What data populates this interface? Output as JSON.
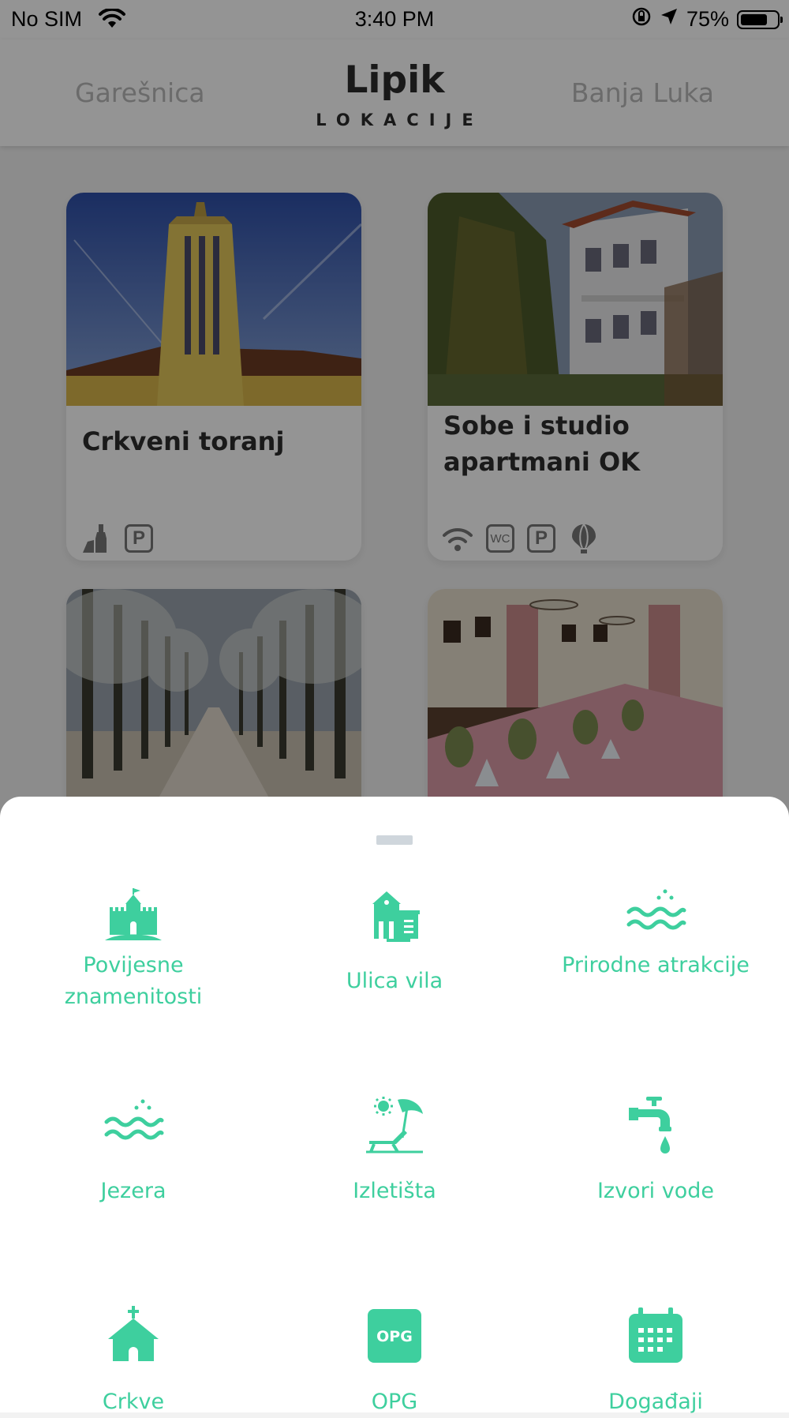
{
  "status_bar": {
    "carrier": "No SIM",
    "time": "3:40 PM",
    "battery": "75%",
    "battery_level": 0.75
  },
  "header": {
    "prev_location": "Garešnica",
    "title": "Lipik",
    "subtitle": "LOKACIJE",
    "next_location": "Banja Luka"
  },
  "cards": [
    {
      "title": "Crkveni toranj",
      "amenities": [
        "wine-icon",
        "parking-icon"
      ]
    },
    {
      "title": "Sobe i studio apartmani OK",
      "amenities": [
        "wifi-icon",
        "wc-icon",
        "parking-icon",
        "balloon-icon"
      ]
    },
    {
      "title": "",
      "amenities": []
    },
    {
      "title": "",
      "amenities": []
    }
  ],
  "amenity_text": {
    "wc": "WC",
    "parking": "P"
  },
  "sheet": {
    "accent_color": "#3ecf9e",
    "categories": [
      {
        "label": "Povijesne znamenitosti",
        "icon": "castle-icon"
      },
      {
        "label": "Ulica vila",
        "icon": "villa-icon"
      },
      {
        "label": "Prirodne atrakcije",
        "icon": "water-waves-icon"
      },
      {
        "label": "Jezera",
        "icon": "lake-icon"
      },
      {
        "label": "Izletišta",
        "icon": "beach-lounger-icon"
      },
      {
        "label": "Izvori vode",
        "icon": "water-tap-icon"
      },
      {
        "label": "Crkve",
        "icon": "church-icon"
      },
      {
        "label": "OPG",
        "icon": "opg-icon"
      },
      {
        "label": "Događaji",
        "icon": "calendar-icon"
      }
    ],
    "opg_badge": "OPG"
  }
}
